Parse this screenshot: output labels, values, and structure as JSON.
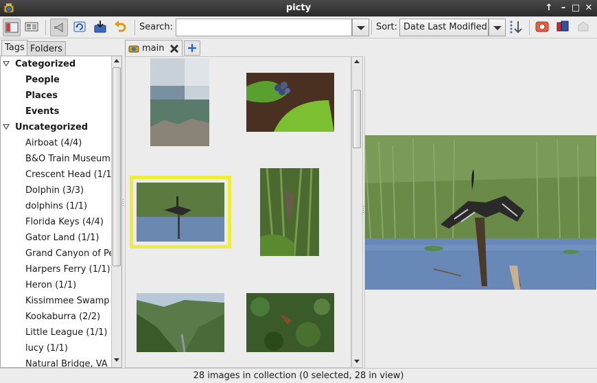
{
  "window": {
    "title": "picty",
    "controls": [
      "up-arrow-icon",
      "minimize-icon",
      "maximize-icon",
      "close-icon"
    ],
    "control_glyphs": {
      "up": "↑",
      "minimize": "–",
      "maximize": "□",
      "close": "✕"
    }
  },
  "toolbar": {
    "search_label": "Search:",
    "search_value": "",
    "sort_label": "Sort:",
    "sort_value": "Date Last Modified",
    "buttons": [
      "sidebar-toggle-icon",
      "layout-icon",
      "scan-icon",
      "refresh-icon",
      "import-icon",
      "undo-icon",
      "clear-search-broom-icon",
      "sort-direction-icon",
      "webupload-icon",
      "export-icon",
      "disabled-action-icon"
    ]
  },
  "sidebar": {
    "tabs": [
      {
        "label": "Tags",
        "active": true
      },
      {
        "label": "Folders",
        "active": false
      }
    ],
    "tree": [
      {
        "label": "Categorized",
        "level": 0,
        "bold": true,
        "expanded": true
      },
      {
        "label": "People",
        "level": 1,
        "bold": true
      },
      {
        "label": "Places",
        "level": 1,
        "bold": true
      },
      {
        "label": "Events",
        "level": 1,
        "bold": true
      },
      {
        "label": "Uncategorized",
        "level": 0,
        "bold": true,
        "expanded": true
      },
      {
        "label": "Airboat (4/4)",
        "level": 1
      },
      {
        "label": "B&O Train Museum",
        "level": 1
      },
      {
        "label": "Crescent Head (1/1",
        "level": 1
      },
      {
        "label": "Dolphin (3/3)",
        "level": 1
      },
      {
        "label": "dolphins (1/1)",
        "level": 1
      },
      {
        "label": "Florida Keys (4/4)",
        "level": 1
      },
      {
        "label": "Gator Land (1/1)",
        "level": 1
      },
      {
        "label": "Grand Canyon of Pe",
        "level": 1
      },
      {
        "label": "Harpers Ferry (1/1)",
        "level": 1
      },
      {
        "label": "Heron (1/1)",
        "level": 1
      },
      {
        "label": "Kissimmee Swamp",
        "level": 1
      },
      {
        "label": "Kookaburra (2/2)",
        "level": 1
      },
      {
        "label": "Little League (1/1)",
        "level": 1
      },
      {
        "label": "lucy (1/1)",
        "level": 1
      },
      {
        "label": "Natural Bridge, VA",
        "level": 1
      }
    ]
  },
  "browser": {
    "tab_label": "main",
    "thumbnails": [
      {
        "name": "thumb-mountain-mist",
        "selected": false
      },
      {
        "name": "thumb-blue-berries",
        "selected": false
      },
      {
        "name": "thumb-anhinga",
        "selected": true
      },
      {
        "name": "thumb-lizard-grass",
        "selected": false
      },
      {
        "name": "thumb-valley",
        "selected": false
      },
      {
        "name": "thumb-forest-bird",
        "selected": false
      }
    ]
  },
  "viewer": {
    "image": "anhinga-bird-large"
  },
  "status": {
    "text": "28 images in collection (0 selected, 28 in view)"
  },
  "colors": {
    "selection": "#f0ec3c",
    "titlebar": "#2a2a2a"
  }
}
